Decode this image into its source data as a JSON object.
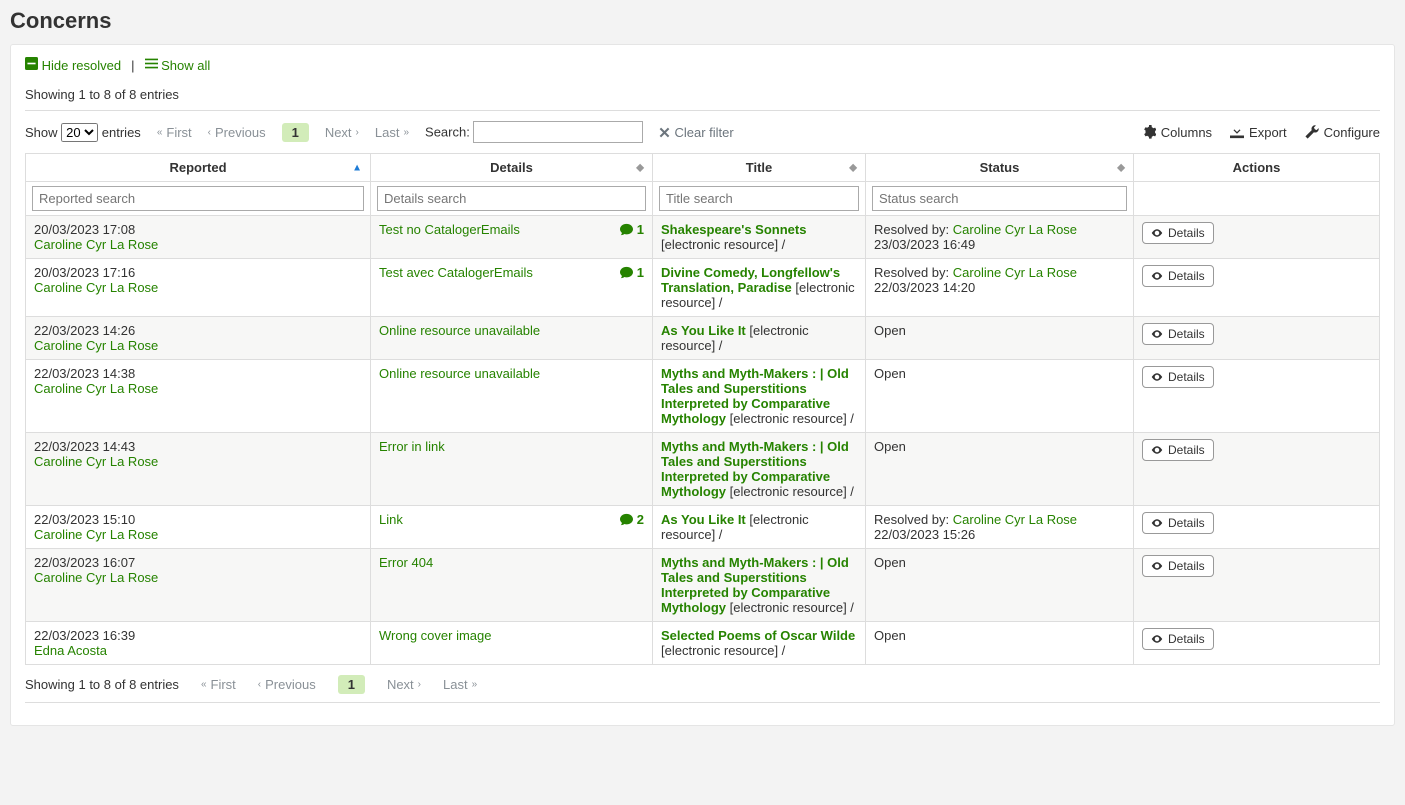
{
  "page_title": "Concerns",
  "hide_resolved": "Hide resolved",
  "show_all": "Show all",
  "showing": "Showing 1 to 8 of 8 entries",
  "show_label": "Show",
  "entries_label": "entries",
  "show_value": "20",
  "pager": {
    "first": "First",
    "prev": "Previous",
    "next": "Next",
    "last": "Last",
    "page": "1"
  },
  "search_label": "Search:",
  "clear_filter": "Clear filter",
  "tools": {
    "columns": "Columns",
    "export": "Export",
    "configure": "Configure"
  },
  "cols": {
    "reported": "Reported",
    "details": "Details",
    "title": "Title",
    "status": "Status",
    "actions": "Actions"
  },
  "ph": {
    "reported": "Reported search",
    "details": "Details search",
    "title": "Title search",
    "status": "Status search"
  },
  "details_btn": "Details",
  "rows": [
    {
      "reported_ts": "20/03/2023 17:08",
      "reporter": "Caroline Cyr La Rose",
      "details": "Test no CatalogerEmails",
      "comments": "1",
      "title": "Shakespeare's Sonnets",
      "title_xtra": "[electronic resource] /",
      "status_prefix": "Resolved by: ",
      "resolver": "Caroline Cyr La Rose",
      "status_ts": "23/03/2023 16:49"
    },
    {
      "reported_ts": "20/03/2023 17:16",
      "reporter": "Caroline Cyr La Rose",
      "details": "Test avec CatalogerEmails",
      "comments": "1",
      "title": "Divine Comedy, Longfellow's Translation, Paradise",
      "title_xtra": "[electronic resource] /",
      "status_prefix": "Resolved by: ",
      "resolver": "Caroline Cyr La Rose",
      "status_ts": "22/03/2023 14:20"
    },
    {
      "reported_ts": "22/03/2023 14:26",
      "reporter": "Caroline Cyr La Rose",
      "details": "Online resource unavailable",
      "comments": "",
      "title": "As You Like It",
      "title_xtra": "[electronic resource] /",
      "status_prefix": "",
      "resolver": "",
      "status_ts": "",
      "status_plain": "Open"
    },
    {
      "reported_ts": "22/03/2023 14:38",
      "reporter": "Caroline Cyr La Rose",
      "details": "Online resource unavailable",
      "comments": "",
      "title": "Myths and Myth-Makers : | Old Tales and Superstitions Interpreted by Comparative Mythology",
      "title_xtra": "[electronic resource] /",
      "status_prefix": "",
      "resolver": "",
      "status_ts": "",
      "status_plain": "Open"
    },
    {
      "reported_ts": "22/03/2023 14:43",
      "reporter": "Caroline Cyr La Rose",
      "details": "Error in link",
      "comments": "",
      "title": "Myths and Myth-Makers : | Old Tales and Superstitions Interpreted by Comparative Mythology",
      "title_xtra": "[electronic resource] /",
      "status_prefix": "",
      "resolver": "",
      "status_ts": "",
      "status_plain": "Open"
    },
    {
      "reported_ts": "22/03/2023 15:10",
      "reporter": "Caroline Cyr La Rose",
      "details": "Link",
      "comments": "2",
      "title": "As You Like It",
      "title_xtra": "[electronic resource] /",
      "status_prefix": "Resolved by: ",
      "resolver": "Caroline Cyr La Rose",
      "status_ts": "22/03/2023 15:26"
    },
    {
      "reported_ts": "22/03/2023 16:07",
      "reporter": "Caroline Cyr La Rose",
      "details": "Error 404",
      "comments": "",
      "title": "Myths and Myth-Makers : | Old Tales and Superstitions Interpreted by Comparative Mythology",
      "title_xtra": "[electronic resource] /",
      "status_prefix": "",
      "resolver": "",
      "status_ts": "",
      "status_plain": "Open"
    },
    {
      "reported_ts": "22/03/2023 16:39",
      "reporter": "Edna Acosta",
      "details": "Wrong cover image",
      "comments": "",
      "title": "Selected Poems of Oscar Wilde",
      "title_xtra": "[electronic resource] /",
      "status_prefix": "",
      "resolver": "",
      "status_ts": "",
      "status_plain": "Open"
    }
  ]
}
